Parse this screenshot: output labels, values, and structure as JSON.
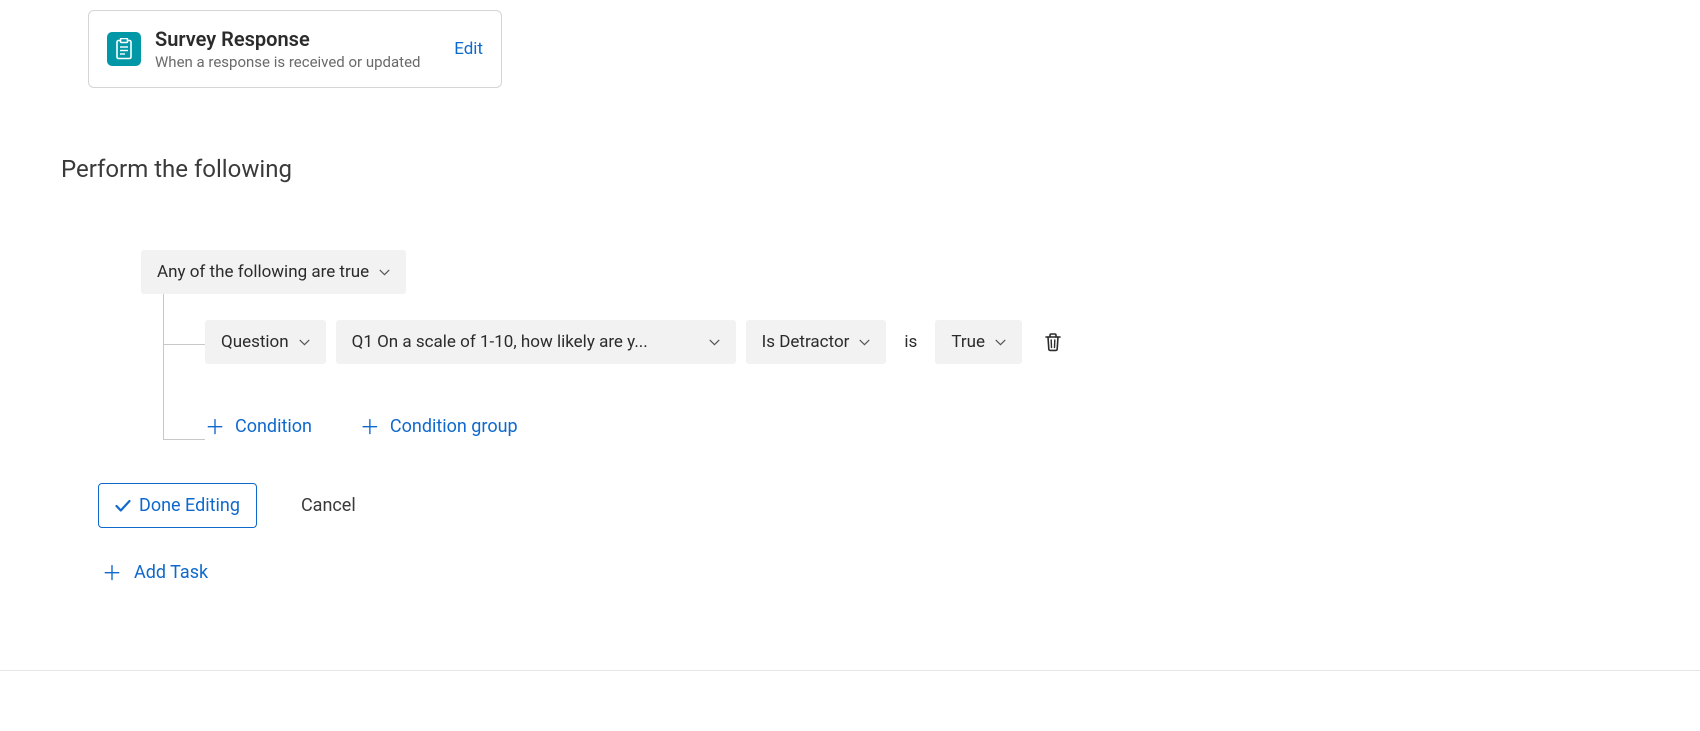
{
  "trigger": {
    "title": "Survey Response",
    "subtitle": "When a response is received or updated",
    "edit_label": "Edit",
    "icon": "clipboard-icon"
  },
  "section_heading": "Perform the following",
  "condition_group": {
    "mode_label": "Any of the following are true",
    "conditions": [
      {
        "field_type": "Question",
        "question": "Q1 On a scale of 1-10, how likely are y...",
        "comparator": "Is Detractor",
        "joiner": "is",
        "value": "True"
      }
    ],
    "add_condition_label": "Condition",
    "add_group_label": "Condition group"
  },
  "buttons": {
    "done_editing": "Done Editing",
    "cancel": "Cancel",
    "add_task": "Add Task"
  }
}
